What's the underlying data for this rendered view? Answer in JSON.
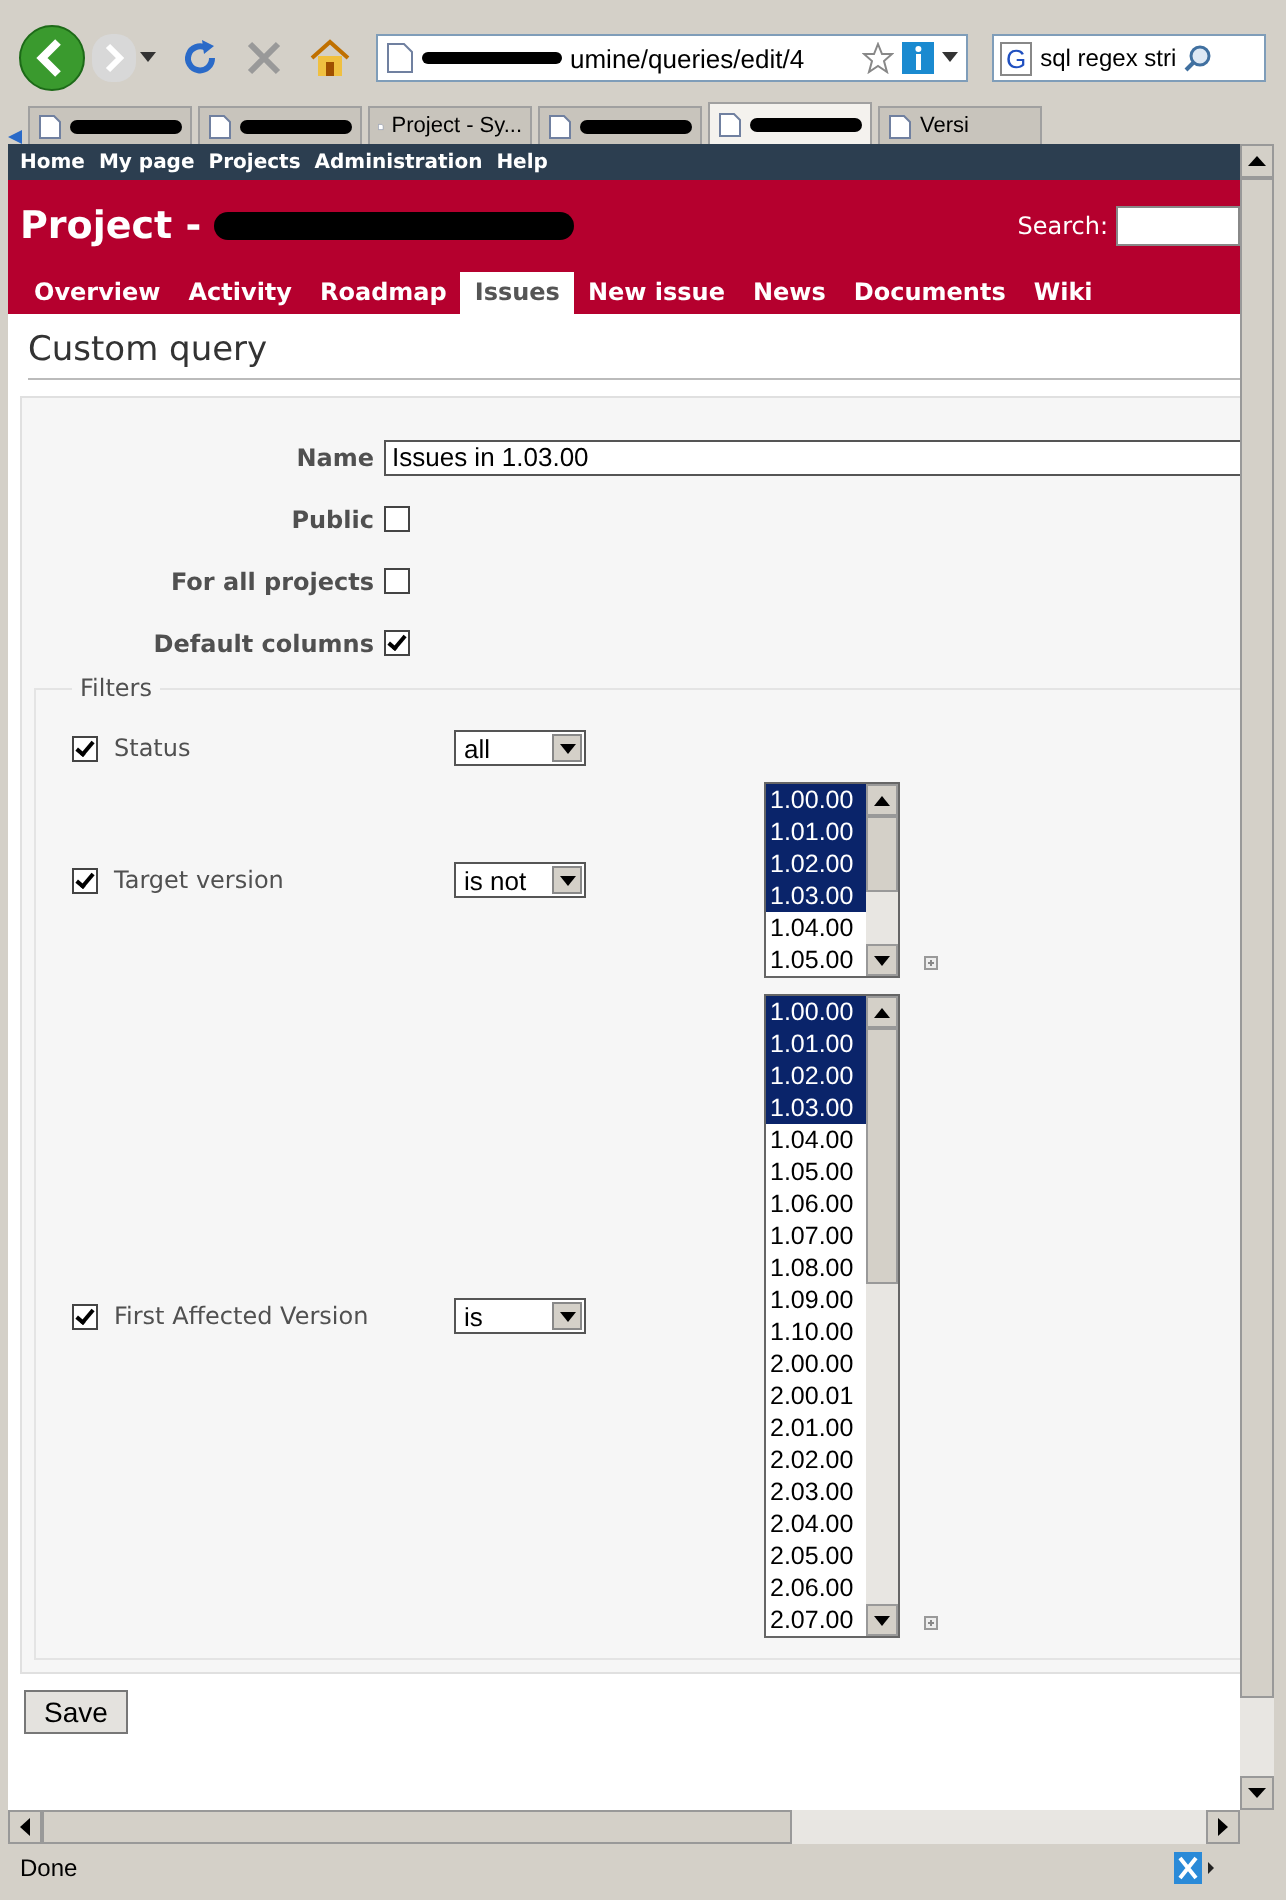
{
  "browser": {
    "url": "umine/queries/edit/4",
    "search_engine": "G",
    "search": "sql regex stri",
    "tabs": [
      {
        "selected": false
      },
      {
        "selected": false
      },
      {
        "label": "Project - Sy...",
        "selected": false
      },
      {
        "selected": false
      },
      {
        "selected": true
      },
      {
        "label": "Versi",
        "selected": false
      }
    ]
  },
  "top_menu": [
    "Home",
    "My page",
    "Projects",
    "Administration",
    "Help"
  ],
  "header": {
    "title": "Project -",
    "search_label": "Search:"
  },
  "tabs": [
    {
      "label": "Overview",
      "selected": false
    },
    {
      "label": "Activity",
      "selected": false
    },
    {
      "label": "Roadmap",
      "selected": false
    },
    {
      "label": "Issues",
      "selected": true
    },
    {
      "label": "New issue",
      "selected": false
    },
    {
      "label": "News",
      "selected": false
    },
    {
      "label": "Documents",
      "selected": false
    },
    {
      "label": "Wiki",
      "selected": false
    }
  ],
  "heading": "Custom query",
  "form": {
    "name_label": "Name",
    "name_value": "Issues in 1.03.00",
    "options": [
      {
        "label": "Public",
        "checked": false
      },
      {
        "label": "For all projects",
        "checked": false
      },
      {
        "label": "Default columns",
        "checked": true
      }
    ]
  },
  "filters_legend": "Filters",
  "filters": [
    {
      "label": "Status",
      "checked": true,
      "operator": "all"
    },
    {
      "label": "Target version",
      "checked": true,
      "operator": "is not",
      "values": [
        {
          "label": "1.00.00",
          "selected": true
        },
        {
          "label": "1.01.00",
          "selected": true
        },
        {
          "label": "1.02.00",
          "selected": true
        },
        {
          "label": "1.03.00",
          "selected": true
        },
        {
          "label": "1.04.00",
          "selected": false
        },
        {
          "label": "1.05.00",
          "selected": false
        }
      ]
    },
    {
      "label": "First Affected Version",
      "checked": true,
      "operator": "is",
      "values": [
        {
          "label": "1.00.00",
          "selected": true
        },
        {
          "label": "1.01.00",
          "selected": true
        },
        {
          "label": "1.02.00",
          "selected": true
        },
        {
          "label": "1.03.00",
          "selected": true
        },
        {
          "label": "1.04.00",
          "selected": false
        },
        {
          "label": "1.05.00",
          "selected": false
        },
        {
          "label": "1.06.00",
          "selected": false
        },
        {
          "label": "1.07.00",
          "selected": false
        },
        {
          "label": "1.08.00",
          "selected": false
        },
        {
          "label": "1.09.00",
          "selected": false
        },
        {
          "label": "1.10.00",
          "selected": false
        },
        {
          "label": "2.00.00",
          "selected": false
        },
        {
          "label": "2.00.01",
          "selected": false
        },
        {
          "label": "2.01.00",
          "selected": false
        },
        {
          "label": "2.02.00",
          "selected": false
        },
        {
          "label": "2.03.00",
          "selected": false
        },
        {
          "label": "2.04.00",
          "selected": false
        },
        {
          "label": "2.05.00",
          "selected": false
        },
        {
          "label": "2.06.00",
          "selected": false
        },
        {
          "label": "2.07.00",
          "selected": false
        }
      ]
    }
  ],
  "save_button": "Save",
  "status_bar": "Done"
}
